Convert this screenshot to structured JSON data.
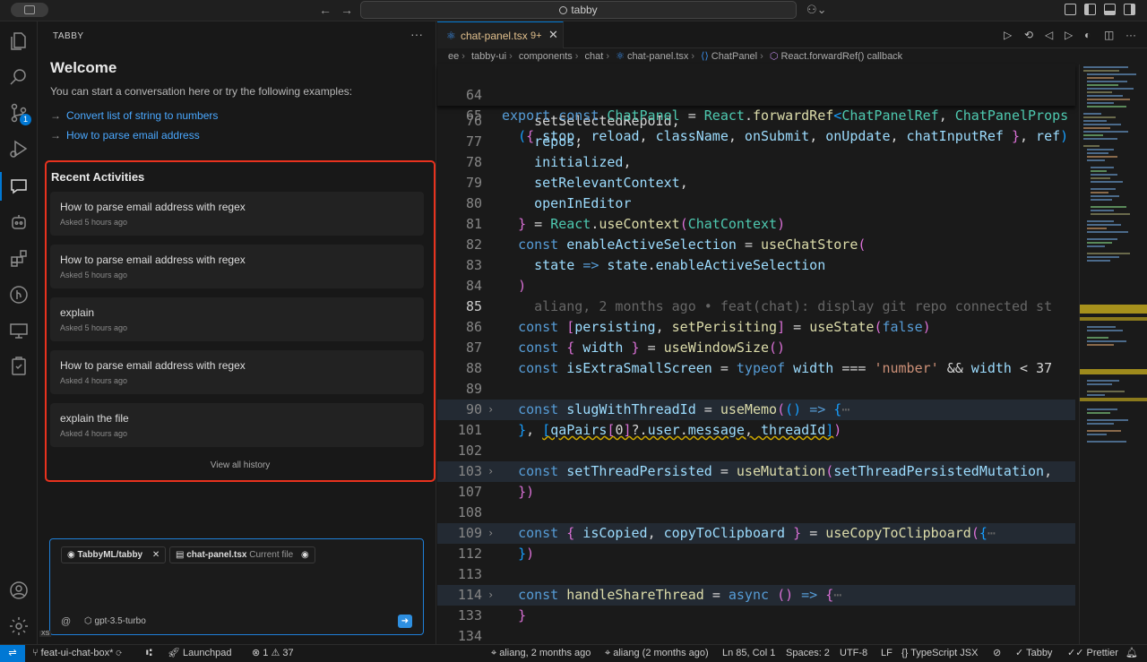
{
  "titlebar": {
    "search_text": "tabby"
  },
  "sidebar": {
    "title": "TABBY",
    "more": "···",
    "welcome_title": "Welcome",
    "welcome_sub": "You can start a conversation here or try the following examples:",
    "examples": [
      "Convert list of string to numbers",
      "How to parse email address"
    ],
    "recent_title": "Recent Activities",
    "recent": [
      {
        "question": "How to parse email address with regex",
        "time": "Asked 5 hours ago"
      },
      {
        "question": "How to parse email address with regex",
        "time": "Asked 5 hours ago"
      },
      {
        "question": "explain",
        "time": "Asked 5 hours ago"
      },
      {
        "question": "How to parse email address with regex",
        "time": "Asked 4 hours ago"
      },
      {
        "question": "explain the file",
        "time": "Asked 4 hours ago"
      }
    ],
    "view_all": "View all history",
    "chat_input": {
      "repo_chip": "TabbyML/tabby",
      "file_chip": "chat-panel.tsx",
      "file_chip_tag": "Current file",
      "at": "@",
      "model": "gpt-3.5-turbo",
      "xs": "XS"
    },
    "activity_badge": "1"
  },
  "editor": {
    "tab_name": "chat-panel.tsx",
    "tab_problems": "9+",
    "breadcrumbs": [
      "ee",
      "tabby-ui",
      "components",
      "chat",
      "chat-panel.tsx",
      "ChatPanel",
      "React.forwardRef() callback"
    ],
    "sticky": [
      {
        "n": "64",
        "code": "export const ChatPanel = React.forwardRef<ChatPanelRef, ChatPanelProps"
      },
      {
        "n": "65",
        "code": "  ({ stop, reload, className, onSubmit, onUpdate, chatInputRef }, ref)"
      }
    ],
    "line_numbers": [
      "76",
      "77",
      "78",
      "79",
      "80",
      "81",
      "82",
      "83",
      "84",
      "85",
      "86",
      "87",
      "88",
      "89",
      "90",
      "101",
      "102",
      "103",
      "107",
      "108",
      "109",
      "112",
      "113",
      "114",
      "133",
      "134"
    ],
    "blame": "aliang, 2 months ago • feat(chat): display git repo connected st"
  },
  "statusbar": {
    "branch": "feat-ui-chat-box*",
    "launchpad": "Launchpad",
    "errors": "1",
    "warnings": "37",
    "blame": "aliang, 2 months ago",
    "author": "aliang (2 months ago)",
    "position": "Ln 85, Col 1",
    "spaces": "Spaces: 2",
    "encoding": "UTF-8",
    "eol": "LF",
    "language": "TypeScript JSX",
    "tabby": "Tabby",
    "prettier": "Prettier"
  }
}
